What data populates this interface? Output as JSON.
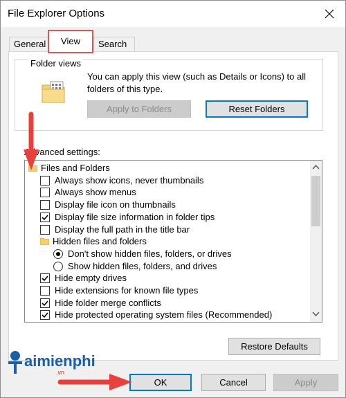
{
  "window": {
    "title": "File Explorer Options"
  },
  "tabs": [
    {
      "label": "General"
    },
    {
      "label": "View"
    },
    {
      "label": "Search"
    }
  ],
  "folder_views": {
    "legend": "Folder views",
    "description_line1": "You can apply this view (such as Details or Icons) to all",
    "description_line2": "folders of this type.",
    "apply_button": "Apply to Folders",
    "reset_button": "Reset Folders"
  },
  "advanced": {
    "label": "Advanced settings:",
    "items": [
      {
        "type": "folder",
        "label": "Files and Folders"
      },
      {
        "type": "check",
        "label": "Always show icons, never thumbnails",
        "checked": false
      },
      {
        "type": "check",
        "label": "Always show menus",
        "checked": false
      },
      {
        "type": "check",
        "label": "Display file icon on thumbnails",
        "checked": false
      },
      {
        "type": "check",
        "label": "Display file size information in folder tips",
        "checked": true
      },
      {
        "type": "check",
        "label": "Display the full path in the title bar",
        "checked": false
      },
      {
        "type": "folder",
        "label": "Hidden files and folders"
      },
      {
        "type": "radio",
        "label": "Don't show hidden files, folders, or drives",
        "checked": true
      },
      {
        "type": "radio",
        "label": "Show hidden files, folders, and drives",
        "checked": false
      },
      {
        "type": "check",
        "label": "Hide empty drives",
        "checked": true
      },
      {
        "type": "check",
        "label": "Hide extensions for known file types",
        "checked": false
      },
      {
        "type": "check",
        "label": "Hide folder merge conflicts",
        "checked": true
      },
      {
        "type": "check",
        "label": "Hide protected operating system files (Recommended)",
        "checked": true
      }
    ]
  },
  "buttons": {
    "restore_defaults": "Restore Defaults",
    "ok": "OK",
    "cancel": "Cancel",
    "apply": "Apply"
  },
  "watermark": {
    "brand": "aimienphi",
    "sub": ".vn"
  },
  "colors": {
    "highlight": "#e05555",
    "focus": "#0078d7",
    "arrow": "#e8413c"
  }
}
